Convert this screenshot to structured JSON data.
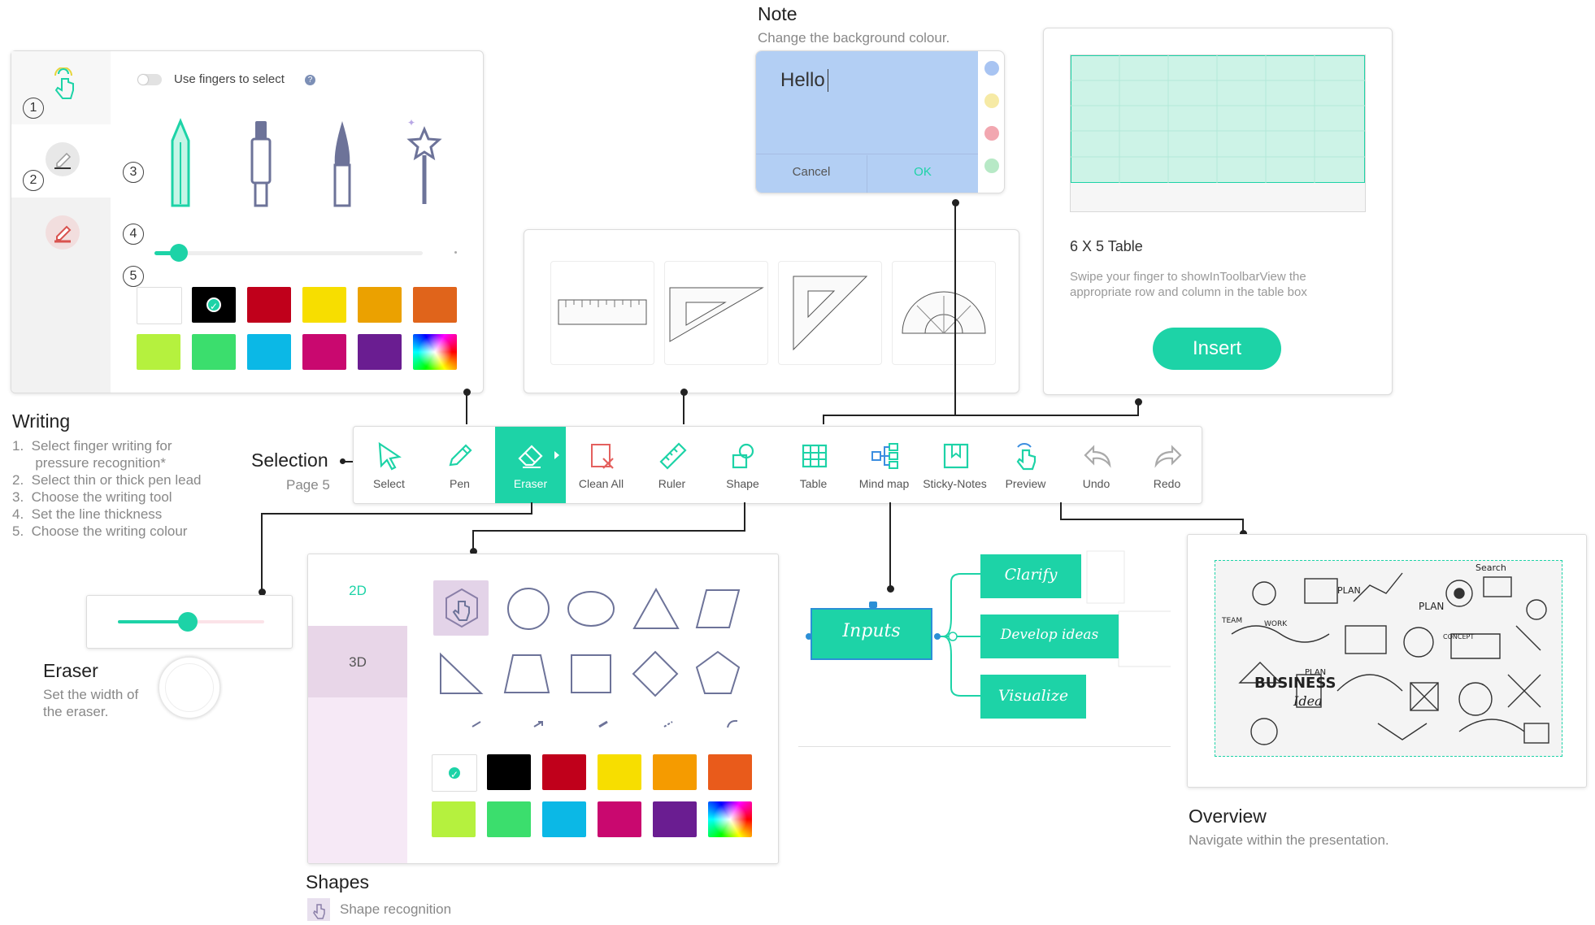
{
  "writing": {
    "title": "Writing",
    "steps": [
      "1.  Select finger writing for",
      "      pressure recognition*",
      "2.  Select thin or thick pen lead",
      "3.  Choose the writing tool",
      "4.  Set the line thickness",
      "5.  Choose the writing colour"
    ],
    "panel": {
      "toggle_label": "Use fingers to select",
      "help": "?",
      "nums": [
        "1",
        "2",
        "3",
        "4",
        "5"
      ],
      "thickness_value": 0.09,
      "colors": [
        "#ffffff",
        "#000000",
        "#c0001b",
        "#f7de00",
        "#eba100",
        "#e0641b",
        "#b5f13e",
        "#3bde6d",
        "#0bb8e6",
        "#c9086f",
        "#6a1d91",
        "rainbow"
      ]
    }
  },
  "selection": {
    "title": "Selection",
    "page": "Page 5"
  },
  "toolbar": {
    "items": [
      {
        "label": "Select",
        "icon": "cursor-icon"
      },
      {
        "label": "Pen",
        "icon": "pen-icon"
      },
      {
        "label": "Eraser",
        "icon": "eraser-icon",
        "active": true
      },
      {
        "label": "Clean All",
        "icon": "clean-all-icon"
      },
      {
        "label": "Ruler",
        "icon": "ruler-icon"
      },
      {
        "label": "Shape",
        "icon": "shape-icon"
      },
      {
        "label": "Table",
        "icon": "table-icon"
      },
      {
        "label": "Mind map",
        "icon": "mind-map-icon"
      },
      {
        "label": "Sticky-Notes",
        "icon": "sticky-note-icon"
      },
      {
        "label": "Preview",
        "icon": "preview-icon"
      },
      {
        "label": "Undo",
        "icon": "undo-icon"
      },
      {
        "label": "Redo",
        "icon": "redo-icon"
      }
    ],
    "accent": "#1dd3a7"
  },
  "note": {
    "title": "Note",
    "subtitle": "Change the background colour.",
    "text": "Hello",
    "cancel": "Cancel",
    "ok": "OK",
    "bg": "#b3cff4",
    "colors": [
      "#a8c4f2",
      "#f6eaa5",
      "#f2a7b0",
      "#b7e9c6"
    ]
  },
  "table": {
    "size": "6 X 5 Table",
    "hint": "Swipe your finger to showInToolbarView the appropriate row and column in the table box",
    "insert": "Insert"
  },
  "eraser": {
    "title": "Eraser",
    "desc_line1": "Set the width of",
    "desc_line2": "the eraser.",
    "width_value": 0.48
  },
  "shapes": {
    "title": "Shapes",
    "recognition": "Shape recognition",
    "tabs": [
      "2D",
      "3D"
    ],
    "colors": [
      "#ffffff",
      "#000000",
      "#c0001b",
      "#f7de00",
      "#f59b00",
      "#e95b1b",
      "#b5f13e",
      "#3bde6d",
      "#0bb8e6",
      "#c9086f",
      "#6a1d91",
      "rainbow"
    ]
  },
  "mindmap": {
    "root": "Inputs",
    "children": [
      "Clarify",
      "Develop ideas",
      "Visualize"
    ]
  },
  "overview": {
    "title": "Overview",
    "subtitle": "Navigate within the presentation.",
    "doodle_words": [
      "BUSINESS",
      "Idea",
      "PLAN",
      "PLAN",
      "Search",
      "WORK",
      "TEAM",
      "PLAN",
      "CONCEPT"
    ]
  }
}
